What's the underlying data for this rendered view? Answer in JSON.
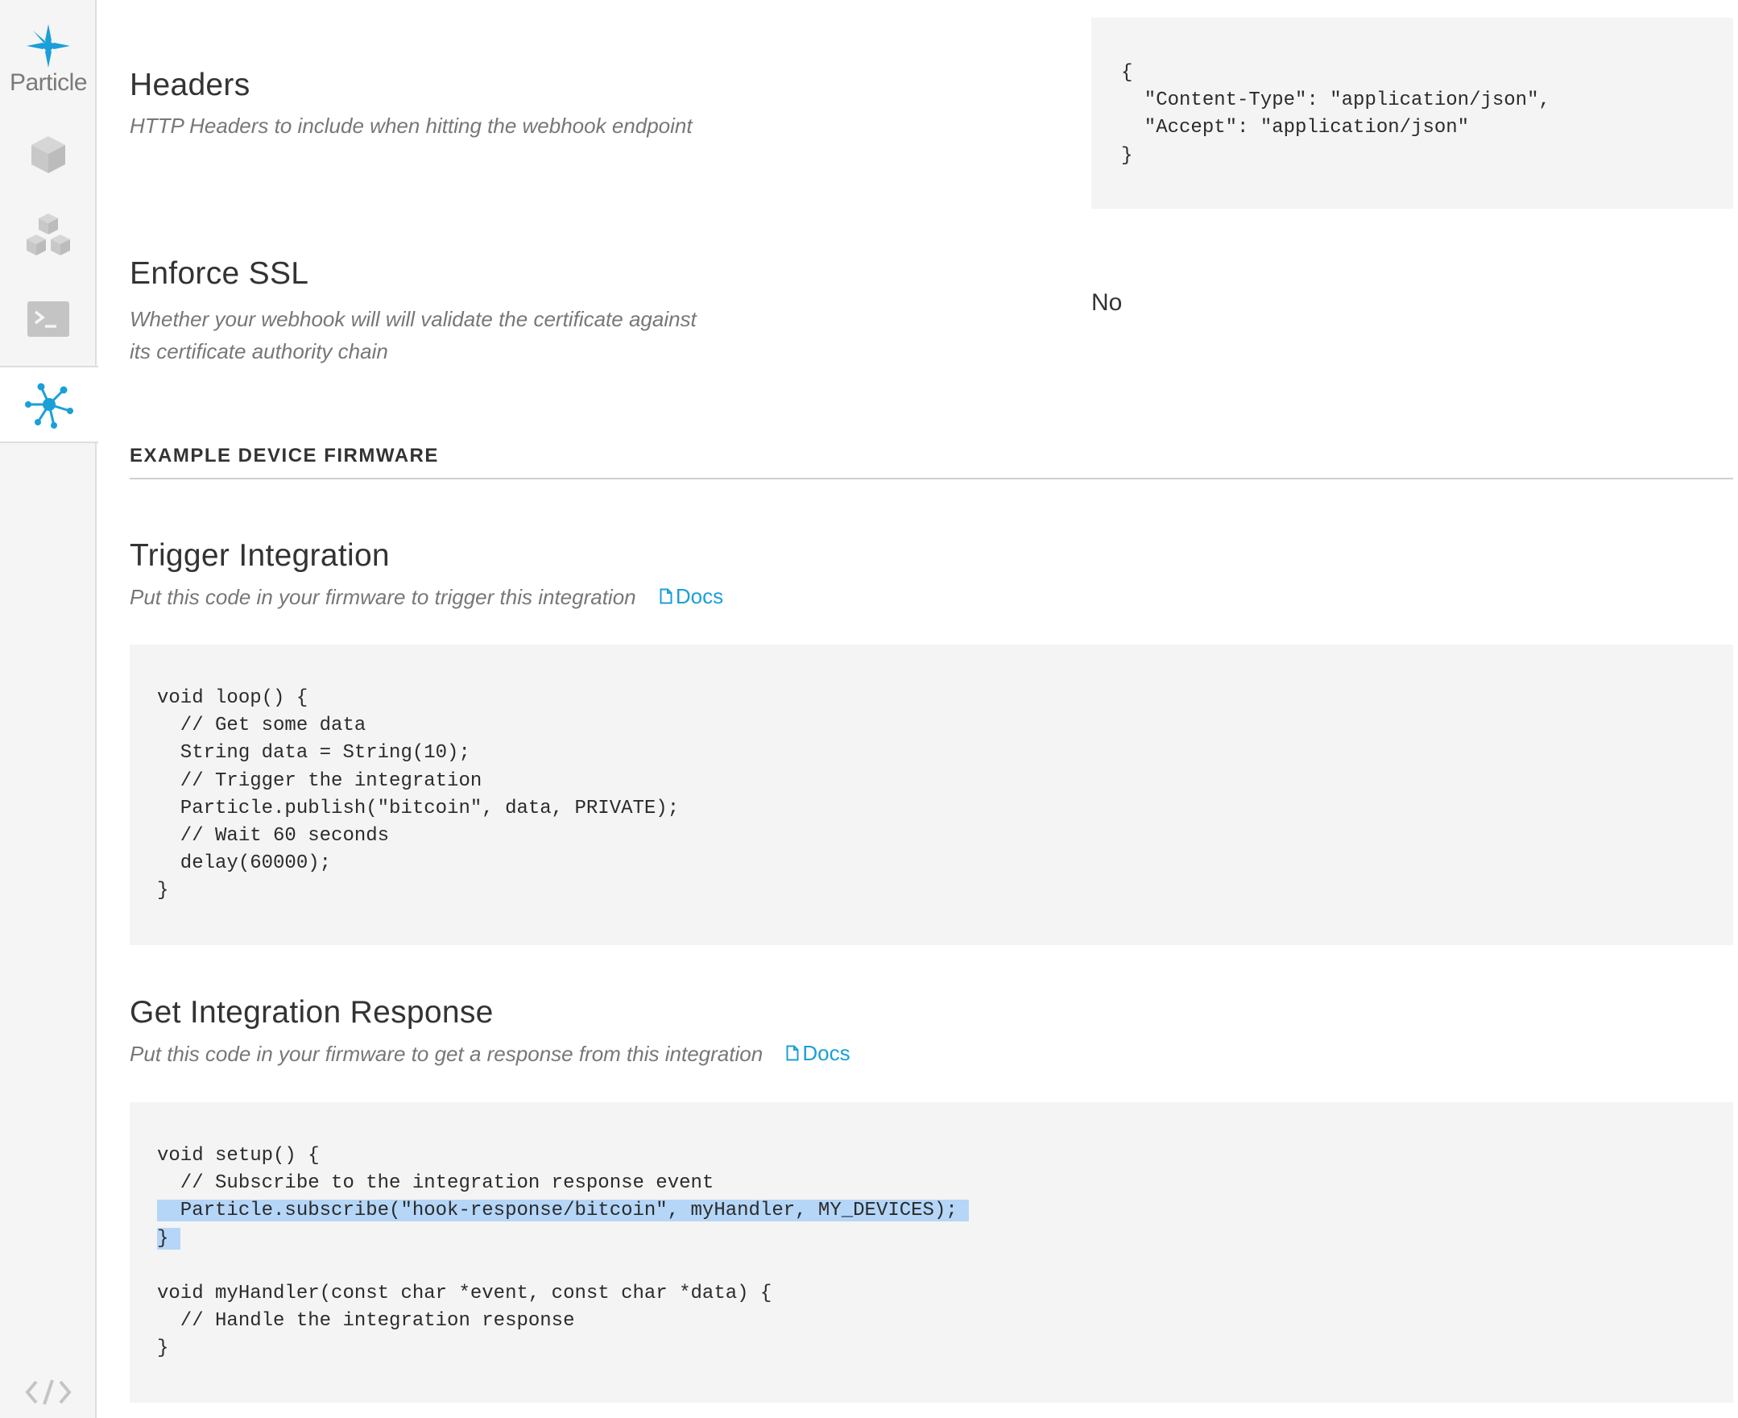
{
  "sidebar": {
    "logo_text": "Particle",
    "items": [
      {
        "name": "devices",
        "icon": "cube-icon"
      },
      {
        "name": "products",
        "icon": "cubes-icon"
      },
      {
        "name": "console",
        "icon": "terminal-icon"
      },
      {
        "name": "integrations",
        "icon": "integrations-hub-icon",
        "active": true
      },
      {
        "name": "developer",
        "icon": "code-icon"
      }
    ],
    "accent_color": "#1a9fd9"
  },
  "headers": {
    "title": "Headers",
    "description": "HTTP Headers to include when hitting the webhook endpoint",
    "code": "{\n  \"Content-Type\": \"application/json\",\n  \"Accept\": \"application/json\"\n}"
  },
  "enforce_ssl": {
    "title": "Enforce SSL",
    "description_line1": "Whether your webhook will will validate the certificate against",
    "description_line2": "its certificate authority chain",
    "value": "No"
  },
  "firmware": {
    "section_title": "EXAMPLE DEVICE FIRMWARE",
    "trigger": {
      "title": "Trigger Integration",
      "description": "Put this code in your firmware to trigger this integration",
      "docs_label": "Docs",
      "code": "void loop() {\n  // Get some data\n  String data = String(10);\n  // Trigger the integration\n  Particle.publish(\"bitcoin\", data, PRIVATE);\n  // Wait 60 seconds\n  delay(60000);\n}"
    },
    "response": {
      "title": "Get Integration Response",
      "description": "Put this code in your firmware to get a response from this integration",
      "docs_label": "Docs",
      "code_line1": "void setup() {",
      "code_line2": "  // Subscribe to the integration response event",
      "code_line3": "  Particle.subscribe(\"hook-response/bitcoin\", myHandler, MY_DEVICES);",
      "code_line4": "}",
      "code_rest": "\nvoid myHandler(const char *event, const char *data) {\n  // Handle the integration response\n}"
    }
  }
}
